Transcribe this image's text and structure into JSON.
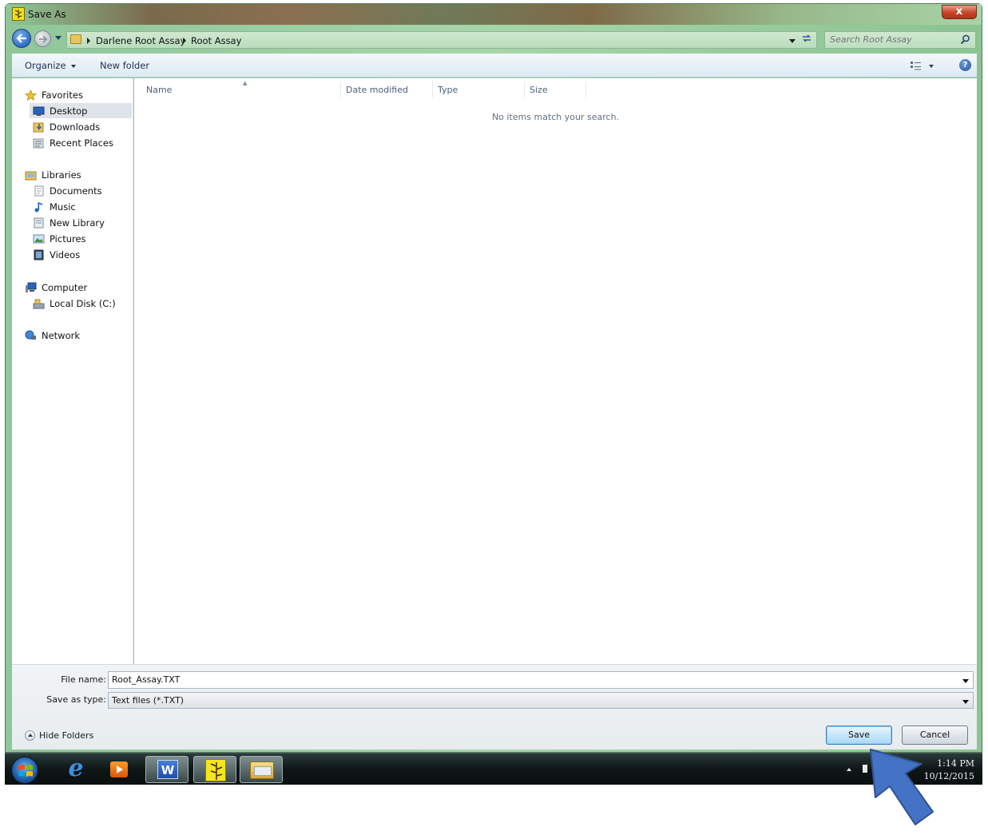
{
  "window": {
    "title": "Save As",
    "close_label": "x"
  },
  "address": {
    "crumbs": [
      "Darlene Root Assay",
      "Root Assay"
    ],
    "search_placeholder": "Search Root Assay"
  },
  "toolbar": {
    "organize": "Organize",
    "new_folder": "New folder",
    "help": "?"
  },
  "nav": {
    "favorites": "Favorites",
    "desktop": "Desktop",
    "downloads": "Downloads",
    "recent_places": "Recent Places",
    "libraries": "Libraries",
    "documents": "Documents",
    "music": "Music",
    "new_library": "New Library",
    "pictures": "Pictures",
    "videos": "Videos",
    "computer": "Computer",
    "local_disk": "Local Disk (C:)",
    "network": "Network"
  },
  "file_list": {
    "columns": [
      "Name",
      "Date modified",
      "Type",
      "Size"
    ],
    "empty_message": "No items match your search."
  },
  "form": {
    "filename_label": "File name:",
    "filename_value": "Root_Assay.TXT",
    "type_label": "Save as type:",
    "type_value": "Text files (*.TXT)",
    "hide_folders": "Hide Folders",
    "save": "Save",
    "cancel": "Cancel"
  },
  "taskbar": {
    "ie_glyph": "e",
    "word_glyph": "W",
    "time": "1:14 PM",
    "date": "10/12/2015"
  },
  "colors": {
    "accent": "#2e6cc4",
    "window_frame": "#9fd1a3",
    "annotation_arrow": "#4472c4"
  }
}
